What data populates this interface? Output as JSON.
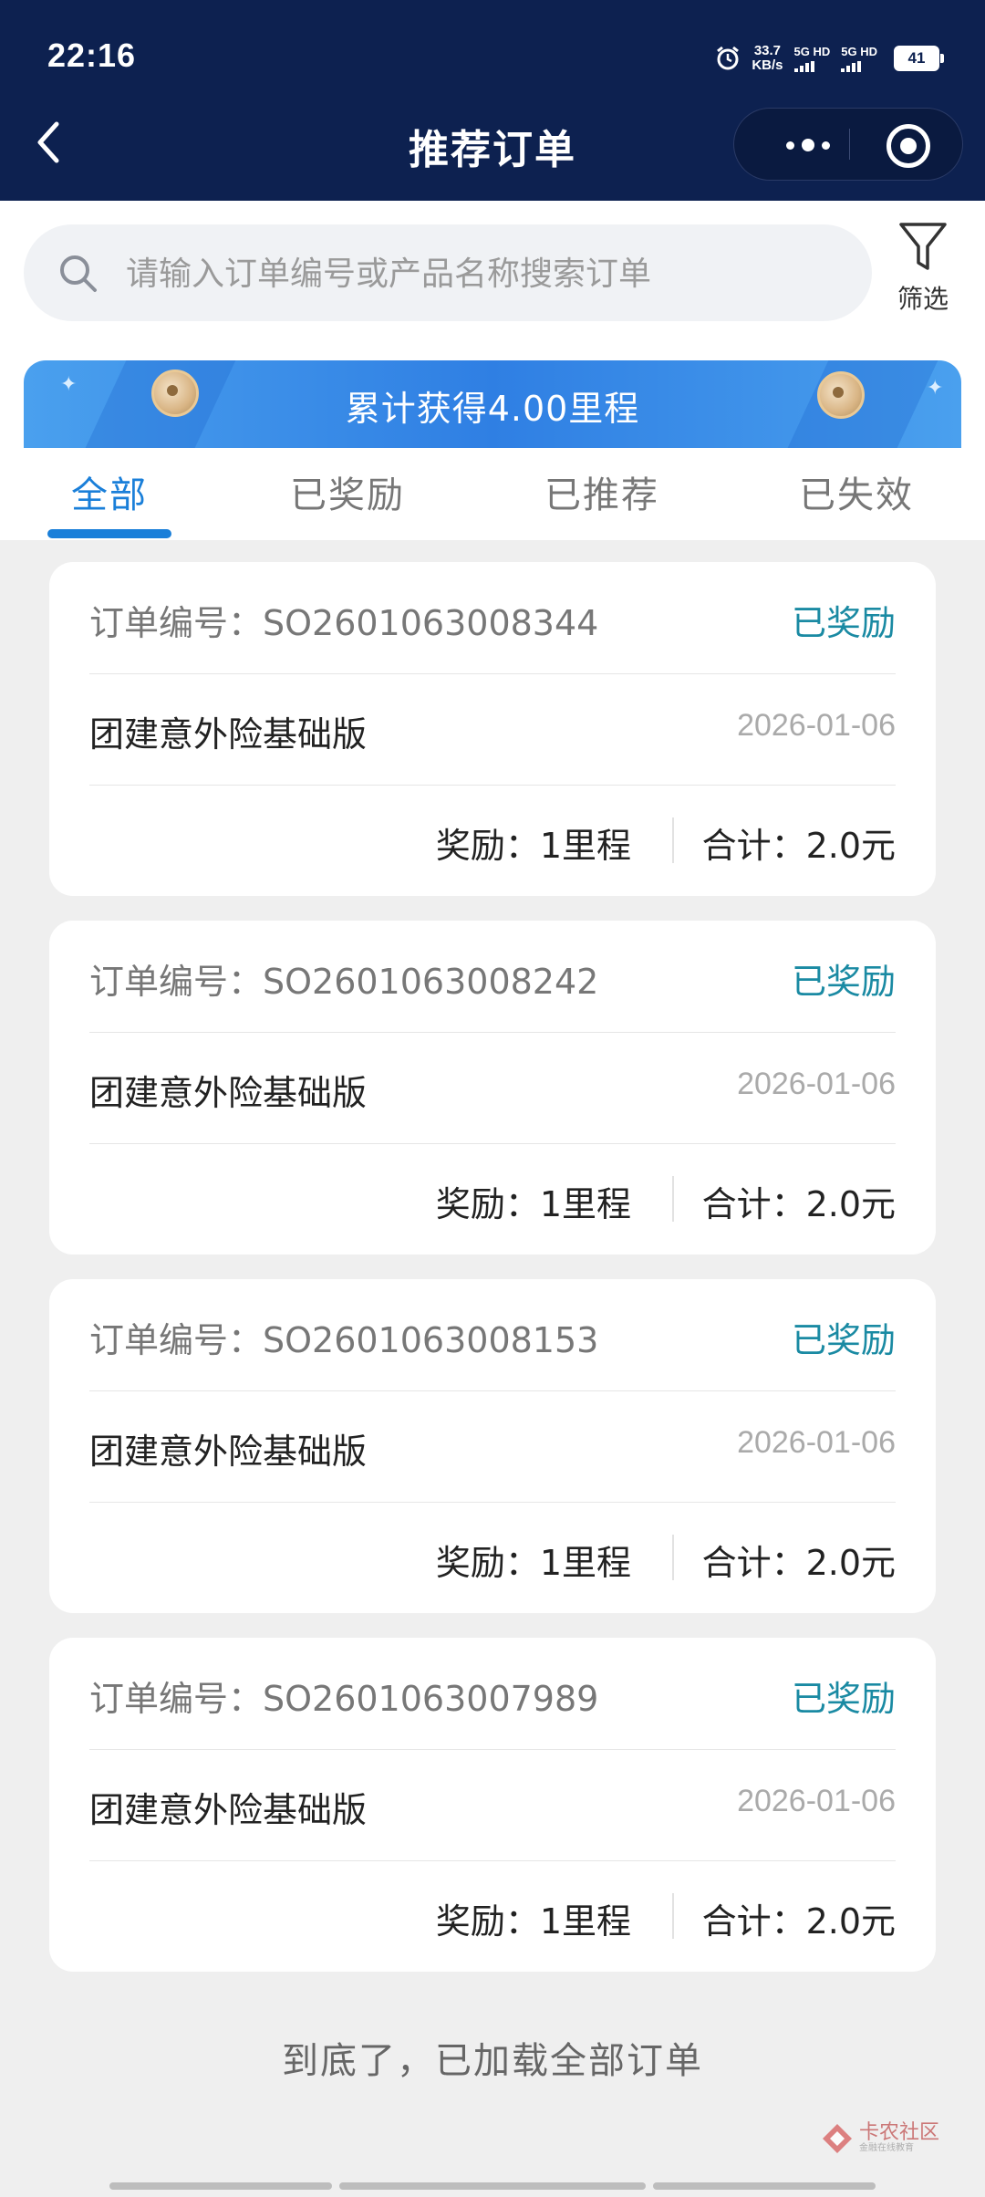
{
  "status_bar": {
    "time": "22:16",
    "speed_value": "33.7",
    "speed_unit": "KB/s",
    "sim1": "5G HD",
    "sim2": "5G HD",
    "battery": "41"
  },
  "header": {
    "title": "推荐订单"
  },
  "search": {
    "placeholder": "请输入订单编号或产品名称搜索订单"
  },
  "filter": {
    "label": "筛选"
  },
  "banner": {
    "text": "累计获得4.00里程"
  },
  "tabs": [
    {
      "label": "全部",
      "active": true
    },
    {
      "label": "已奖励",
      "active": false
    },
    {
      "label": "已推荐",
      "active": false
    },
    {
      "label": "已失效",
      "active": false
    }
  ],
  "orders": [
    {
      "order_no": "订单编号：SO2601063008344",
      "status": "已奖励",
      "product": "团建意外险基础版",
      "date": "2026-01-06",
      "reward": "奖励：1里程",
      "total": "合计：2.0元"
    },
    {
      "order_no": "订单编号：SO2601063008242",
      "status": "已奖励",
      "product": "团建意外险基础版",
      "date": "2026-01-06",
      "reward": "奖励：1里程",
      "total": "合计：2.0元"
    },
    {
      "order_no": "订单编号：SO2601063008153",
      "status": "已奖励",
      "product": "团建意外险基础版",
      "date": "2026-01-06",
      "reward": "奖励：1里程",
      "total": "合计：2.0元"
    },
    {
      "order_no": "订单编号：SO2601063007989",
      "status": "已奖励",
      "product": "团建意外险基础版",
      "date": "2026-01-06",
      "reward": "奖励：1里程",
      "total": "合计：2.0元"
    }
  ],
  "footer": {
    "end_text": "到底了，已加载全部订单"
  },
  "watermark": {
    "text": "卡农社区",
    "sub": "金融在线教育"
  },
  "colors": {
    "header_bg": "#0d2150",
    "accent": "#1a7fd9",
    "status_text": "#1a8aa3",
    "page_bg": "#efefef"
  }
}
